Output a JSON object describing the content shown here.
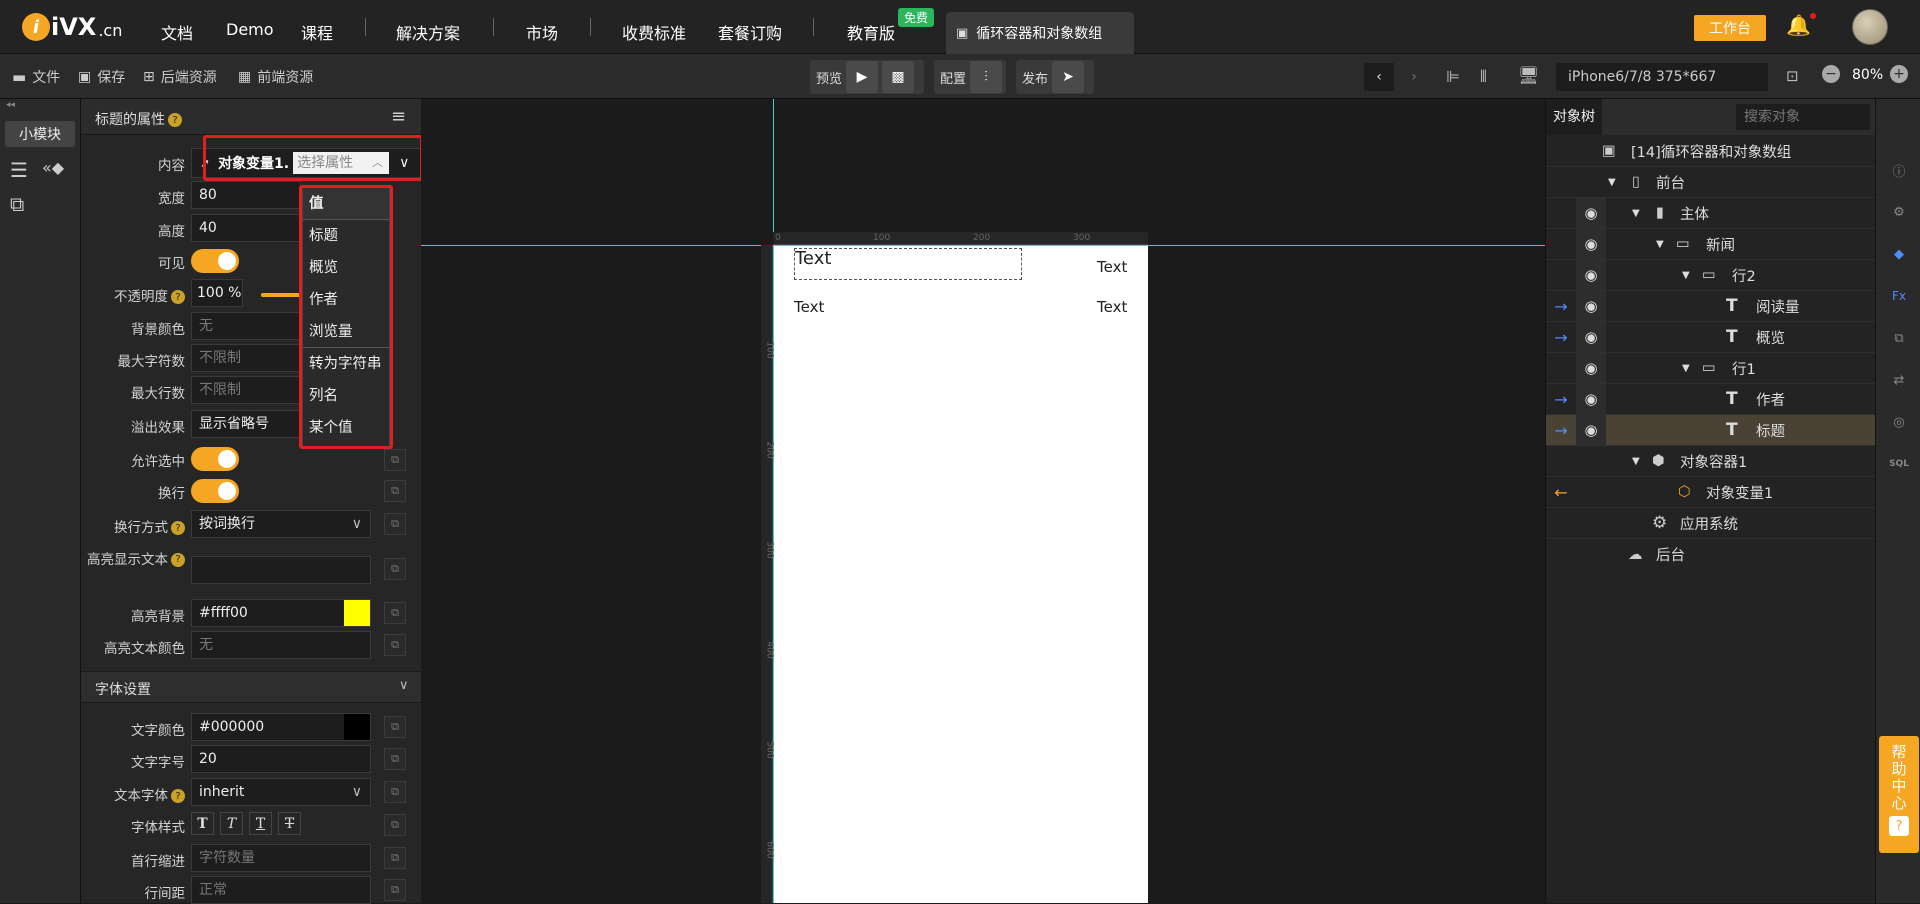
{
  "brand": {
    "logo": "iVX",
    "domain": ".cn"
  },
  "nav": {
    "items": [
      "文档",
      "Demo",
      "课程",
      "解决方案",
      "市场",
      "收费标准",
      "套餐订购",
      "教育版"
    ],
    "free_badge": "免费",
    "active_tab": "循环容器和对象数组",
    "workbench": "工作台"
  },
  "toolbar": {
    "file": "文件",
    "save": "保存",
    "backend": "后端资源",
    "frontend": "前端资源",
    "preview": "预览",
    "config": "配置",
    "publish": "发布",
    "device": "iPhone6/7/8 375*667",
    "zoom": "80%"
  },
  "left_rail": {
    "module": "小模块"
  },
  "props": {
    "title": "标题的属性",
    "content_label": "内容",
    "content_var": "对象变量1.",
    "content_placeholder": "选择属性",
    "width_label": "宽度",
    "width": "80",
    "height_label": "高度",
    "height": "40",
    "visible_label": "可见",
    "opacity_label": "不透明度",
    "opacity": "100 %",
    "bg_label": "背景颜色",
    "bg": "无",
    "maxchars_label": "最大字符数",
    "maxchars": "不限制",
    "maxlines_label": "最大行数",
    "maxlines": "不限制",
    "overflow_label": "溢出效果",
    "overflow": "显示省略号",
    "selectable_label": "允许选中",
    "wrap_label": "换行",
    "wrapmode_label": "换行方式",
    "wrapmode": "按词换行",
    "highlight_label": "高亮显示文本",
    "highlight_bg_label": "高亮背景",
    "highlight_bg": "#ffff00",
    "highlight_color_label": "高亮文本颜色",
    "highlight_color": "无",
    "font_section": "字体设置",
    "textcolor_label": "文字颜色",
    "textcolor": "#000000",
    "fontsize_label": "文字字号",
    "fontsize": "20",
    "fontfamily_label": "文本字体",
    "fontfamily": "inherit",
    "fontstyle_label": "字体样式",
    "indent_label": "首行缩进",
    "indent": "字符数量",
    "lineheight_label": "行间距",
    "lineheight": "正常"
  },
  "dropdown": {
    "items": [
      "值",
      "标题",
      "概览",
      "作者",
      "浏览量",
      "转为字符串",
      "列名",
      "某个值"
    ]
  },
  "canvas": {
    "texts": [
      "Text",
      "Text",
      "Text",
      "Text"
    ],
    "ruler_top": [
      "0",
      "100",
      "200",
      "300"
    ],
    "ruler_left": [
      "100",
      "200",
      "300",
      "400",
      "500",
      "600"
    ]
  },
  "tree": {
    "tab": "对象树",
    "search_placeholder": "搜索对象",
    "nodes": [
      "[14]循环容器和对象数组",
      "前台",
      "主体",
      "新闻",
      "行2",
      "阅读量",
      "概览",
      "行1",
      "作者",
      "标题",
      "对象容器1",
      "对象变量1",
      "应用系统",
      "后台"
    ]
  },
  "help": {
    "label": "帮助中心"
  },
  "colors": {
    "accent": "#f5a623",
    "highlight": "#ffff00",
    "selection_border": "#e02020"
  }
}
